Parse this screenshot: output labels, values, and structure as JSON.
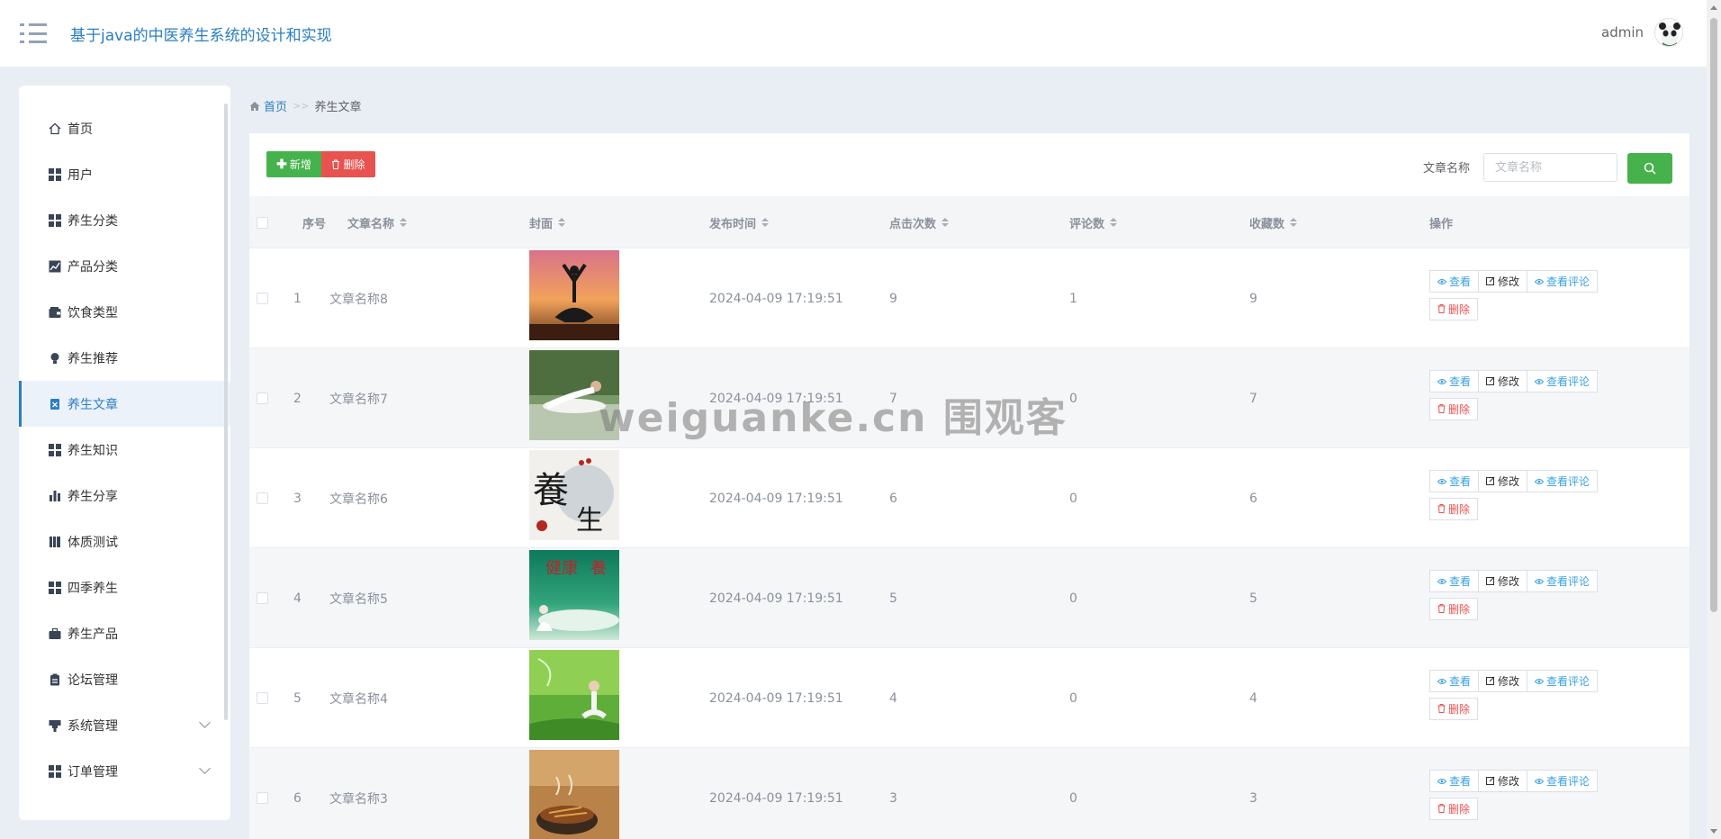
{
  "header": {
    "title": "基于java的中医养生系统的设计和实现",
    "username": "admin"
  },
  "sidebar": {
    "items": [
      {
        "label": "首页",
        "icon": "home-icon"
      },
      {
        "label": "用户",
        "icon": "grid-icon"
      },
      {
        "label": "养生分类",
        "icon": "grid-icon"
      },
      {
        "label": "产品分类",
        "icon": "chart-line-icon"
      },
      {
        "label": "饮食类型",
        "icon": "wallet-icon"
      },
      {
        "label": "养生推荐",
        "icon": "bulb-icon"
      },
      {
        "label": "养生文章",
        "icon": "document-icon",
        "active": true
      },
      {
        "label": "养生知识",
        "icon": "grid-icon"
      },
      {
        "label": "养生分享",
        "icon": "bar-chart-icon"
      },
      {
        "label": "体质测试",
        "icon": "book-icon"
      },
      {
        "label": "四季养生",
        "icon": "grid-icon"
      },
      {
        "label": "养生产品",
        "icon": "briefcase-icon"
      },
      {
        "label": "论坛管理",
        "icon": "clipboard-icon"
      },
      {
        "label": "系统管理",
        "icon": "monitor-icon",
        "expandable": true
      },
      {
        "label": "订单管理",
        "icon": "grid-icon",
        "expandable": true
      }
    ]
  },
  "breadcrumb": {
    "home": "首页",
    "sep": ">>",
    "current": "养生文章"
  },
  "toolbar": {
    "add_label": "新增",
    "delete_label": "删除",
    "search_label": "文章名称",
    "search_placeholder": "文章名称"
  },
  "table": {
    "columns": [
      "序号",
      "文章名称",
      "封面",
      "发布时间",
      "点击次数",
      "评论数",
      "收藏数",
      "操作"
    ],
    "actions": {
      "view": "查看",
      "edit": "修改",
      "comments": "查看评论",
      "delete": "删除"
    },
    "rows": [
      {
        "index": "1",
        "name": "文章名称8",
        "time": "2024-04-09 17:19:51",
        "clicks": "9",
        "comments": "1",
        "favorites": "9",
        "cover": "yoga-sunset"
      },
      {
        "index": "2",
        "name": "文章名称7",
        "time": "2024-04-09 17:19:51",
        "clicks": "7",
        "comments": "0",
        "favorites": "7",
        "cover": "yoga-stretch"
      },
      {
        "index": "3",
        "name": "文章名称6",
        "time": "2024-04-09 17:19:51",
        "clicks": "6",
        "comments": "0",
        "favorites": "6",
        "cover": "calligraphy"
      },
      {
        "index": "4",
        "name": "文章名称5",
        "time": "2024-04-09 17:19:51",
        "clicks": "5",
        "comments": "0",
        "favorites": "5",
        "cover": "health-poster"
      },
      {
        "index": "5",
        "name": "文章名称4",
        "time": "2024-04-09 17:19:51",
        "clicks": "4",
        "comments": "0",
        "favorites": "4",
        "cover": "meditation-bamboo"
      },
      {
        "index": "6",
        "name": "文章名称3",
        "time": "2024-04-09 17:19:51",
        "clicks": "3",
        "comments": "0",
        "favorites": "3",
        "cover": "herbal-soup"
      }
    ]
  },
  "watermark": "weiguanke.cn 围观客"
}
